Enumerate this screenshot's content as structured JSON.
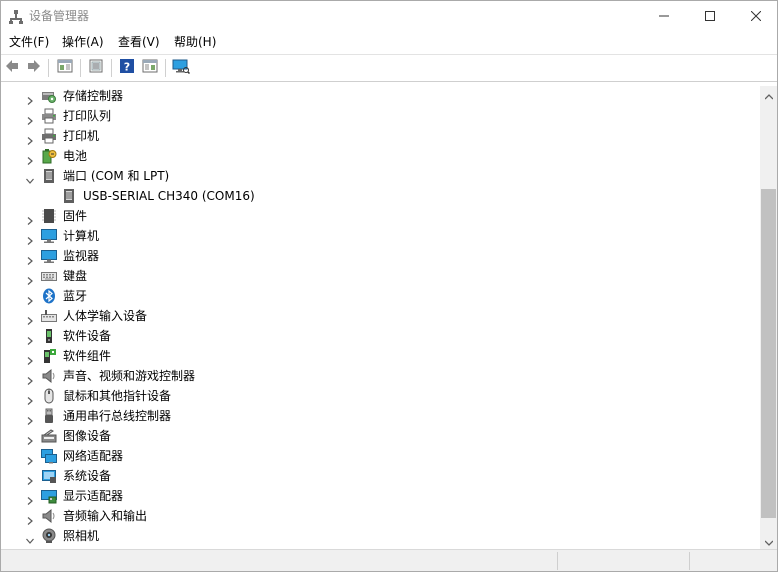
{
  "window": {
    "title": "设备管理器",
    "controls": {
      "minimize": "minimize-icon",
      "maximize": "maximize-icon",
      "close": "close-icon"
    }
  },
  "menu": [
    {
      "label": "文件(F)"
    },
    {
      "label": "操作(A)"
    },
    {
      "label": "查看(V)"
    },
    {
      "label": "帮助(H)"
    }
  ],
  "toolbar": {
    "icons": [
      "back-arrow-icon",
      "forward-arrow-icon",
      "show-hide-tree-icon",
      "properties-icon",
      "help-icon",
      "action-pane-icon",
      "scan-hardware-icon"
    ]
  },
  "tree": {
    "nodes": [
      {
        "label": "存储控制器",
        "icon": "storage-controller-icon",
        "expanded": false,
        "level": 0
      },
      {
        "label": "打印队列",
        "icon": "print-queue-icon",
        "expanded": false,
        "level": 0
      },
      {
        "label": "打印机",
        "icon": "printer-icon",
        "expanded": false,
        "level": 0
      },
      {
        "label": "电池",
        "icon": "battery-icon",
        "expanded": false,
        "level": 0
      },
      {
        "label": "端口 (COM 和 LPT)",
        "icon": "port-icon",
        "expanded": true,
        "level": 0
      },
      {
        "label": "USB-SERIAL CH340 (COM16)",
        "icon": "port-device-icon",
        "expanded": null,
        "level": 1
      },
      {
        "label": "固件",
        "icon": "firmware-icon",
        "expanded": false,
        "level": 0
      },
      {
        "label": "计算机",
        "icon": "computer-icon",
        "expanded": false,
        "level": 0
      },
      {
        "label": "监视器",
        "icon": "monitor-icon",
        "expanded": false,
        "level": 0
      },
      {
        "label": "键盘",
        "icon": "keyboard-icon",
        "expanded": false,
        "level": 0
      },
      {
        "label": "蓝牙",
        "icon": "bluetooth-icon",
        "expanded": false,
        "level": 0
      },
      {
        "label": "人体学输入设备",
        "icon": "hid-icon",
        "expanded": false,
        "level": 0
      },
      {
        "label": "软件设备",
        "icon": "software-device-icon",
        "expanded": false,
        "level": 0
      },
      {
        "label": "软件组件",
        "icon": "software-component-icon",
        "expanded": false,
        "level": 0
      },
      {
        "label": "声音、视频和游戏控制器",
        "icon": "speaker-icon",
        "expanded": false,
        "level": 0
      },
      {
        "label": "鼠标和其他指针设备",
        "icon": "mouse-icon",
        "expanded": false,
        "level": 0
      },
      {
        "label": "通用串行总线控制器",
        "icon": "usb-icon",
        "expanded": false,
        "level": 0
      },
      {
        "label": "图像设备",
        "icon": "imaging-device-icon",
        "expanded": false,
        "level": 0
      },
      {
        "label": "网络适配器",
        "icon": "network-adapter-icon",
        "expanded": false,
        "level": 0
      },
      {
        "label": "系统设备",
        "icon": "system-device-icon",
        "expanded": false,
        "level": 0
      },
      {
        "label": "显示适配器",
        "icon": "display-adapter-icon",
        "expanded": false,
        "level": 0
      },
      {
        "label": "音频输入和输出",
        "icon": "audio-io-icon",
        "expanded": false,
        "level": 0
      },
      {
        "label": "照相机",
        "icon": "camera-icon",
        "expanded": true,
        "level": 0
      }
    ]
  },
  "colors": {
    "chevron": "#5a5a5a",
    "title_text": "#8a8a8a",
    "accent_blue": "#1e73c8",
    "monitor_blue": "#2d9fe0",
    "help_blue": "#1f4fa3"
  }
}
